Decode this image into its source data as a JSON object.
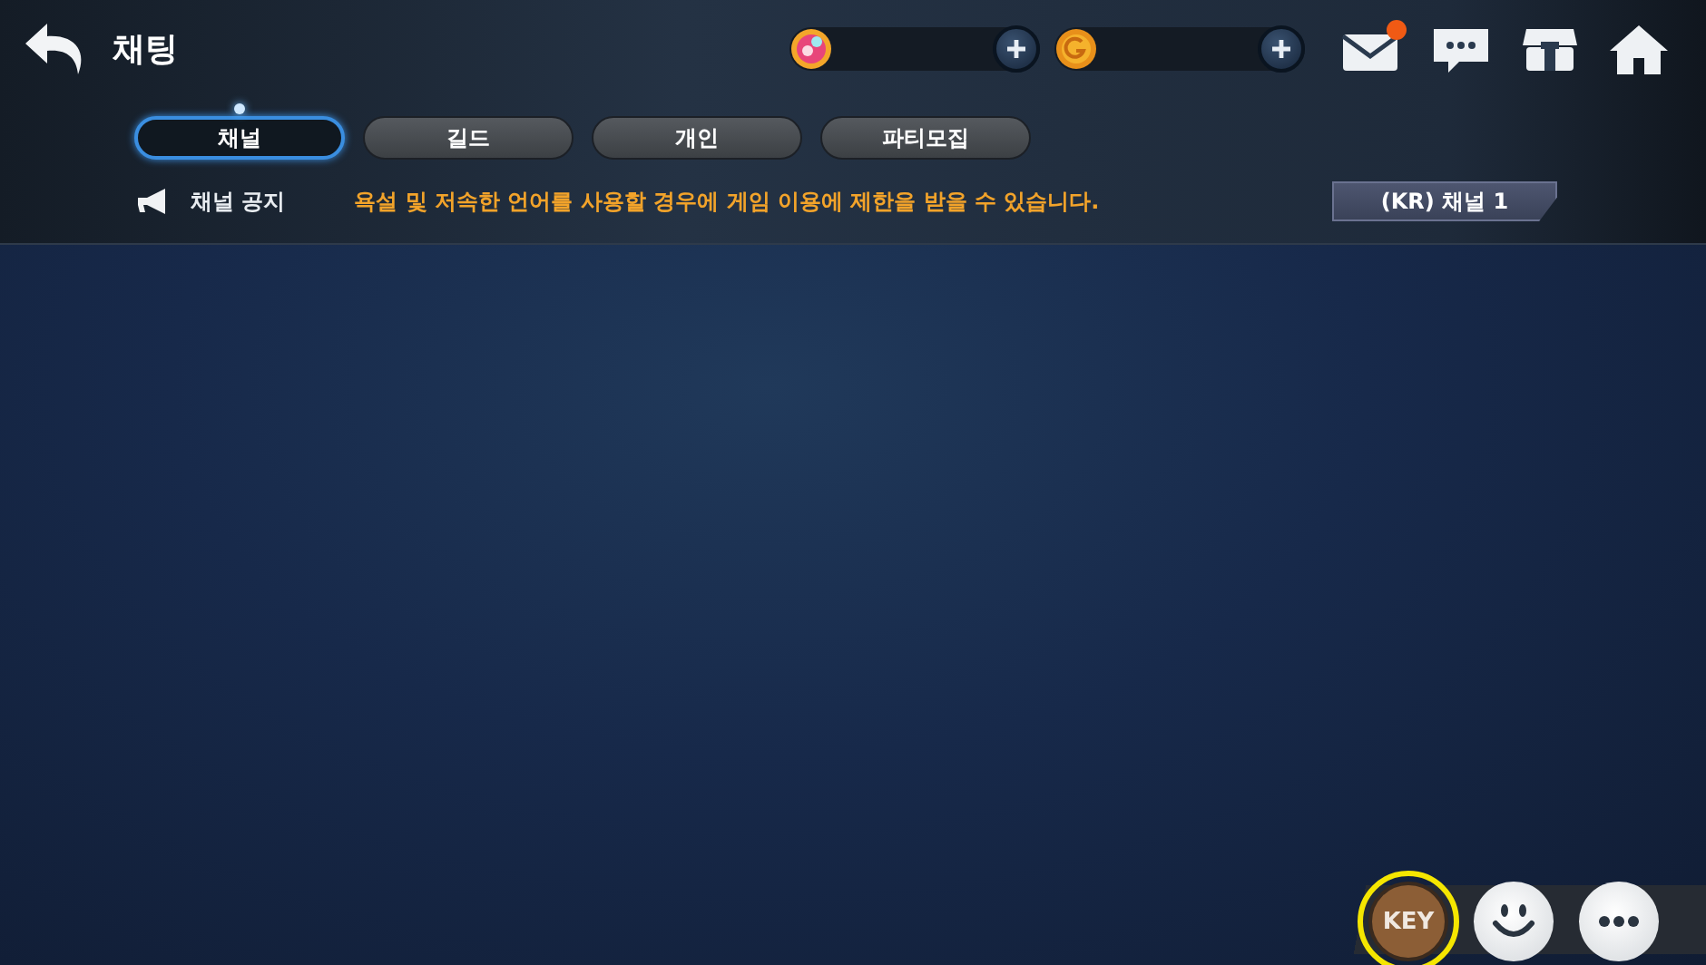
{
  "header": {
    "title": "채팅"
  },
  "currencies": [
    {
      "kind": "gem"
    },
    {
      "kind": "gold"
    }
  ],
  "header_icons": [
    {
      "kind": "mail",
      "badge": true
    },
    {
      "kind": "chat",
      "badge": false
    },
    {
      "kind": "shop",
      "badge": false
    },
    {
      "kind": "home",
      "badge": false
    }
  ],
  "tabs": [
    {
      "label": "채널",
      "selected": true
    },
    {
      "label": "길드",
      "selected": false
    },
    {
      "label": "개인",
      "selected": false
    },
    {
      "label": "파티모집",
      "selected": false
    }
  ],
  "notice": {
    "label": "채널 공지",
    "text": "욕설 및 저속한 언어를 사용할 경우에 게임 이용에 제한을 받을 수 있습니다."
  },
  "channel_button": {
    "label": "(KR) 채널 1"
  },
  "bottom_buttons": [
    {
      "kind": "key",
      "label": "KEY",
      "highlighted": true
    },
    {
      "kind": "emoji",
      "highlighted": false
    },
    {
      "kind": "chat",
      "highlighted": false
    }
  ]
}
